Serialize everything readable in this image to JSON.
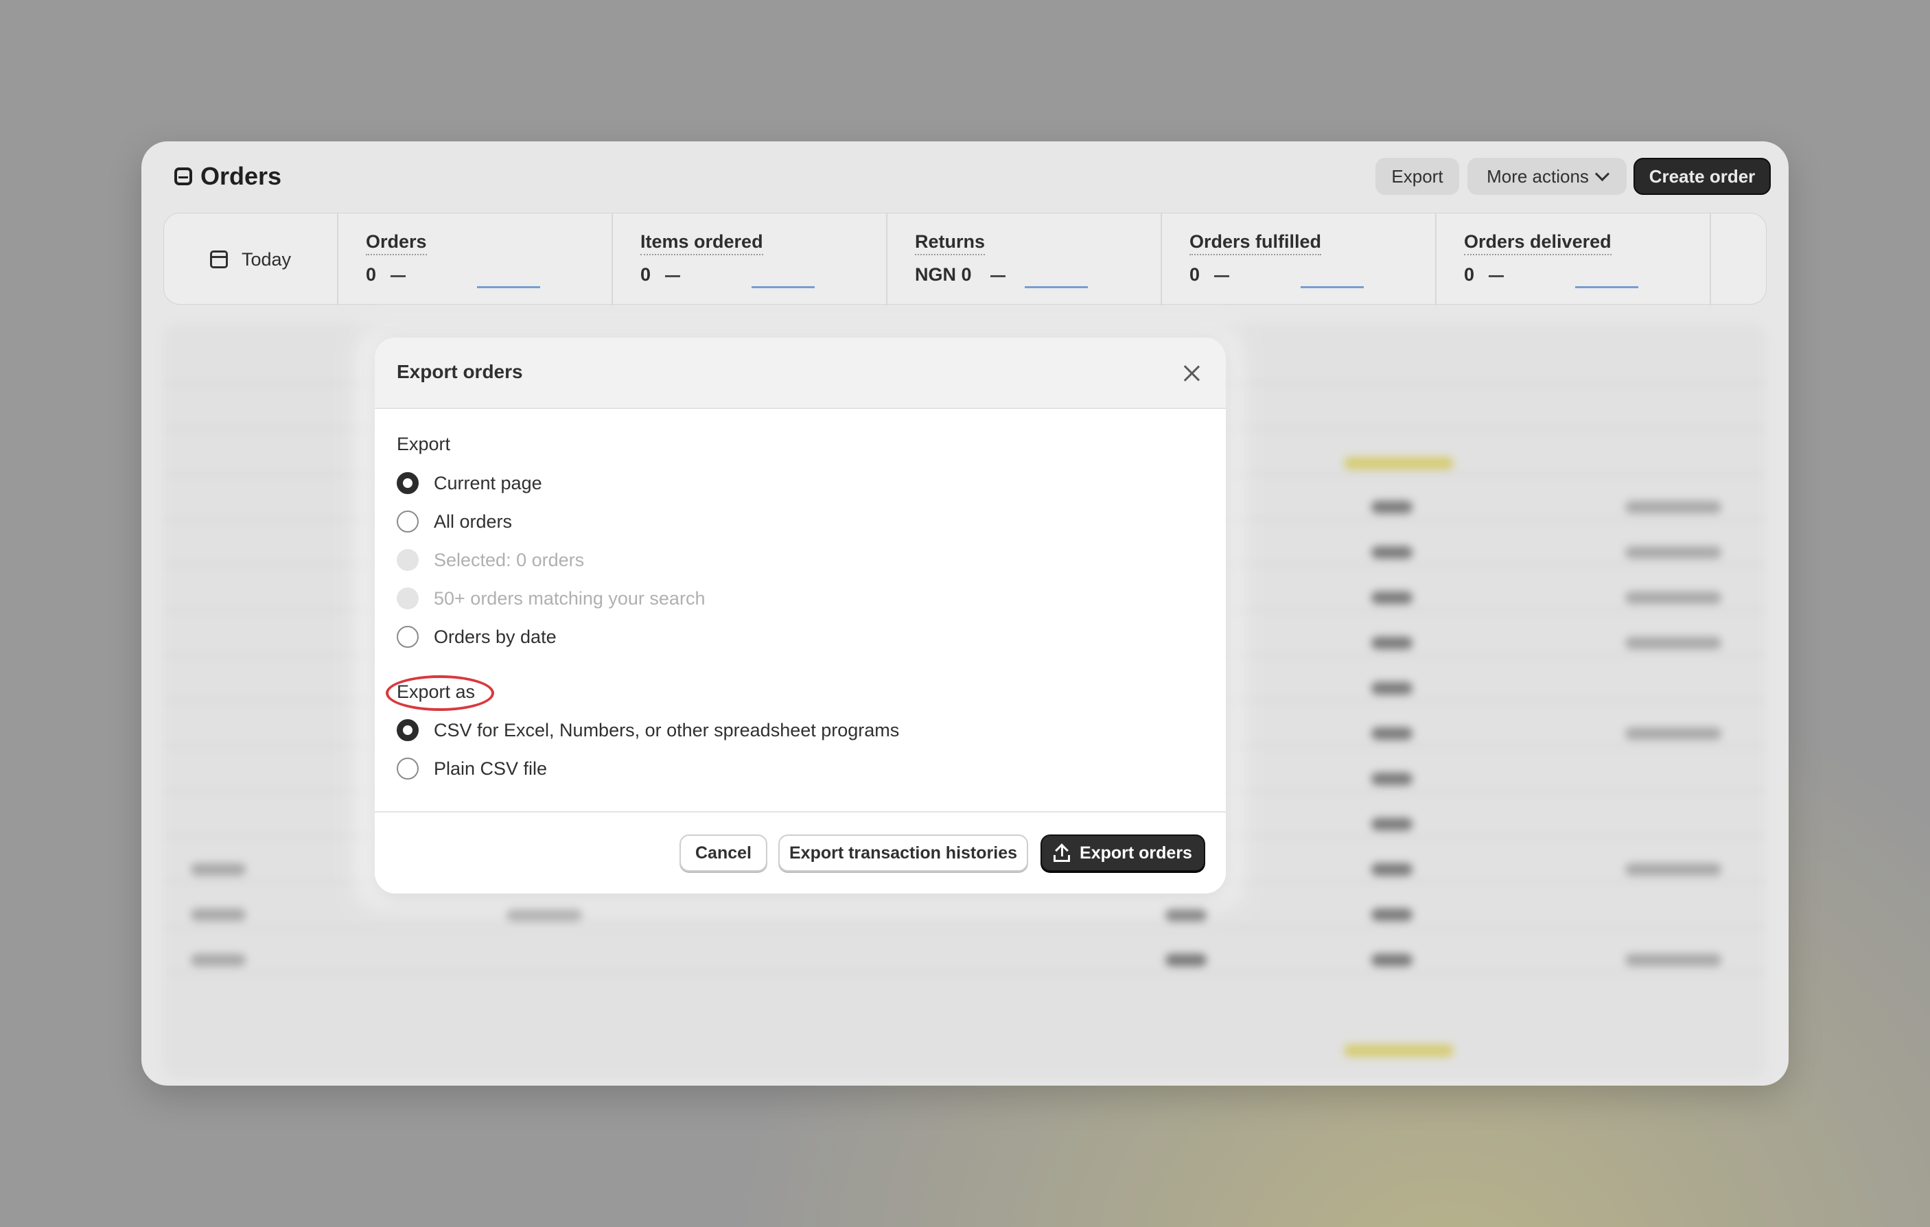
{
  "header": {
    "title": "Orders",
    "export_label": "Export",
    "more_actions_label": "More actions",
    "create_order_label": "Create order"
  },
  "metrics": {
    "date_label": "Today",
    "items": [
      {
        "label": "Orders",
        "value": "0"
      },
      {
        "label": "Items ordered",
        "value": "0"
      },
      {
        "label": "Returns",
        "value": "NGN 0"
      },
      {
        "label": "Orders fulfilled",
        "value": "0"
      },
      {
        "label": "Orders delivered",
        "value": "0"
      }
    ]
  },
  "modal": {
    "title": "Export orders",
    "export_section": {
      "label": "Export",
      "options": [
        {
          "label": "Current page",
          "checked": true,
          "disabled": false
        },
        {
          "label": "All orders",
          "checked": false,
          "disabled": false
        },
        {
          "label": "Selected: 0 orders",
          "checked": false,
          "disabled": true
        },
        {
          "label": "50+ orders matching your search",
          "checked": false,
          "disabled": true
        },
        {
          "label": "Orders by date",
          "checked": false,
          "disabled": false
        }
      ]
    },
    "export_as_section": {
      "label": "Export as",
      "options": [
        {
          "label": "CSV for Excel, Numbers, or other spreadsheet programs",
          "checked": true
        },
        {
          "label": "Plain CSV file",
          "checked": false
        }
      ]
    },
    "footer": {
      "cancel_label": "Cancel",
      "transaction_label": "Export transaction histories",
      "primary_label": "Export orders"
    }
  },
  "colors": {
    "annotation": "#d8393d",
    "primary_button": "#2f2f2f",
    "sparkline": "#4f83c7"
  }
}
